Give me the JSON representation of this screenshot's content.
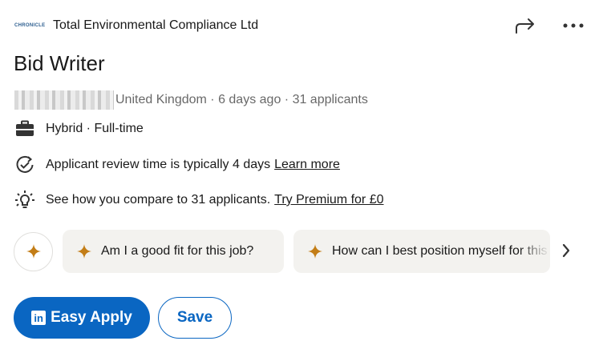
{
  "header": {
    "company_logo_text": "CHRONICLE",
    "company_name": "Total Environmental Compliance Ltd",
    "share_icon": "share-arrow-icon",
    "more_icon": "more-dots-icon"
  },
  "job": {
    "title": "Bid Writer",
    "meta": "United Kingdom · 6 days ago · 31 applicants",
    "workplace": "Hybrid · Full-time",
    "review_time": "Applicant review time is typically 4 days",
    "review_link": "Learn more",
    "compare": "See how you compare to 31 applicants.",
    "premium_link": "Try Premium for £0"
  },
  "prompts": {
    "chip1": "Am I a good fit for this job?",
    "chip2": "How can I best position myself for this job?"
  },
  "actions": {
    "apply_logo": "in",
    "apply_label": "Easy Apply",
    "save_label": "Save"
  },
  "colors": {
    "brand": "#0a66c2",
    "spark": "#c37d16",
    "chip_bg": "#f3f2ef"
  }
}
